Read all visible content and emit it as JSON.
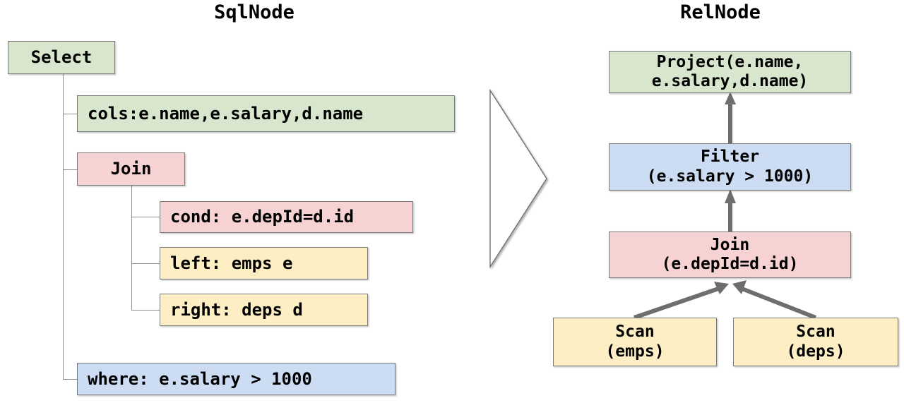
{
  "panels": {
    "left_title": "SqlNode",
    "right_title": "RelNode"
  },
  "sql_tree": {
    "root": {
      "label": "Select",
      "color": "#d8e6cd"
    },
    "children": [
      {
        "label": "cols:e.name,e.salary,d.name",
        "color": "#d8e6cd"
      },
      {
        "label": "Join",
        "color": "#f6d2d2"
      },
      {
        "label": "where: e.salary > 1000",
        "color": "#ccdcf3"
      }
    ],
    "join_children": [
      {
        "label": "cond: e.depId=d.id",
        "color": "#f6d2d2"
      },
      {
        "label": "left: emps e",
        "color": "#fdeec4"
      },
      {
        "label": "right: deps d",
        "color": "#fdeec4"
      }
    ]
  },
  "rel_tree": {
    "nodes": [
      {
        "line1": "Project(e.name,",
        "line2": "e.salary,d.name)",
        "color": "#d8e6cd"
      },
      {
        "line1": "Filter",
        "line2": "(e.salary > 1000)",
        "color": "#ccdcf3"
      },
      {
        "line1": "Join",
        "line2": "(e.depId=d.id)",
        "color": "#f6d2d2"
      },
      {
        "line1": "Scan",
        "line2": "(emps)",
        "color": "#fdeec4"
      },
      {
        "line1": "Scan",
        "line2": "(deps)",
        "color": "#fdeec4"
      }
    ]
  },
  "transform": {
    "arrow_name": "right-arrow",
    "arrow_color": "#ffffff",
    "arrow_stroke": "#6f6f6f"
  },
  "styling": {
    "connector_color": "#8f8f8f",
    "rel_arrow_color": "#6e6e6e",
    "box_border": "#7a7a7a"
  }
}
